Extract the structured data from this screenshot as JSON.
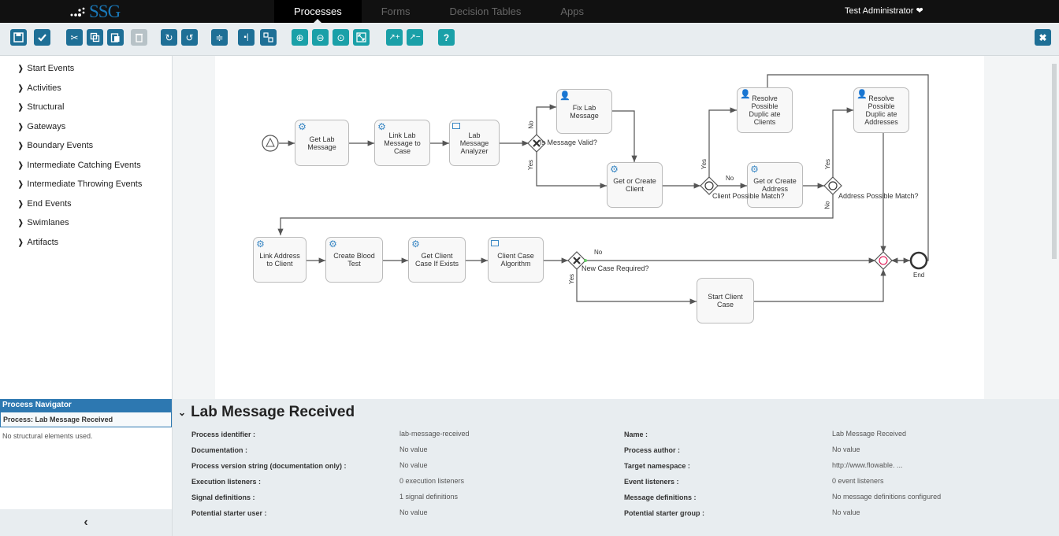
{
  "app": {
    "logo": "SSG",
    "user": "Test Administrator ❤"
  },
  "nav": {
    "tabs": [
      "Processes",
      "Forms",
      "Decision Tables",
      "Apps"
    ],
    "active": 0
  },
  "toolbar": {
    "icons": [
      "save-icon",
      "validate-icon",
      "cut-icon",
      "copy-icon",
      "paste-icon",
      "delete-icon",
      "redo-icon",
      "undo-icon",
      "align-horizontal-icon",
      "align-vertical-icon",
      "same-size-icon",
      "zoom-in-icon",
      "zoom-out-icon",
      "zoom-actual-icon",
      "zoom-fit-icon",
      "bend-point-add-icon",
      "bend-point-remove-icon",
      "help-icon",
      "close-icon"
    ]
  },
  "palette": {
    "items": [
      "Start Events",
      "Activities",
      "Structural",
      "Gateways",
      "Boundary Events",
      "Intermediate Catching Events",
      "Intermediate Throwing Events",
      "End Events",
      "Swimlanes",
      "Artifacts"
    ]
  },
  "diagram": {
    "tasks": {
      "get_lab": "Get Lab Message",
      "link_lab": "Link Lab Message to Case",
      "analyzer": "Lab Message Analyzer",
      "fix_lab": "Fix Lab Message",
      "get_client": "Get or Create Client",
      "resolve_clients": "Resolve Possible Duplic ate Clients",
      "get_address": "Get or Create Address",
      "resolve_addresses": "Resolve Possible Duplic ate Addresses",
      "link_address": "Link Address to Client",
      "blood_test": "Create Blood Test",
      "get_client_case": "Get Client Case If Exists",
      "case_algorithm": "Client Case Algorithm",
      "start_case": "Start Client Case"
    },
    "gateways": {
      "message_valid": "Is Message Valid?",
      "client_match": "Client Possible Match?",
      "address_match": "Address Possible Match?",
      "new_case": "New Case Required?"
    },
    "flow_labels": {
      "yes": "Yes",
      "no": "No"
    },
    "end_label": "End"
  },
  "navigator": {
    "title": "Process Navigator",
    "process": "Process: Lab Message Received",
    "empty": "No structural elements used.",
    "collapse": "‹"
  },
  "properties": {
    "title": "Lab Message Received",
    "rows": [
      {
        "k1": "Process identifier :",
        "v1": "lab-message-received",
        "k2": "Name :",
        "v2": "Lab Message Received"
      },
      {
        "k1": "Documentation :",
        "v1": "No value",
        "k2": "Process author :",
        "v2": "No value"
      },
      {
        "k1": "Process version string (documentation only) :",
        "v1": "No value",
        "k2": "Target namespace :",
        "v2": "http://www.flowable. ..."
      },
      {
        "k1": "Execution listeners :",
        "v1": "0 execution listeners",
        "k2": "Event listeners :",
        "v2": "0 event listeners"
      },
      {
        "k1": "Signal definitions :",
        "v1": "1 signal definitions",
        "k2": "Message definitions :",
        "v2": "No message definitions configured"
      },
      {
        "k1": "Potential starter user :",
        "v1": "No value",
        "k2": "Potential starter group :",
        "v2": "No value"
      }
    ]
  }
}
